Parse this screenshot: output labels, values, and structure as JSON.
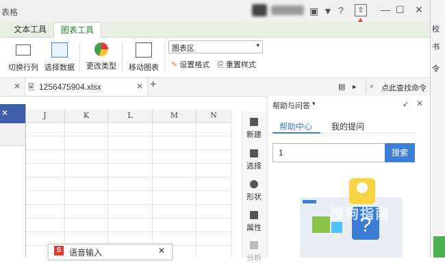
{
  "window": {
    "title": "表格",
    "close": "✕",
    "minimize": "—",
    "maximize": "☐"
  },
  "ribbon_tabs": [
    {
      "label": "文本工具"
    },
    {
      "label": "图表工具"
    }
  ],
  "ribbon": {
    "switch_row_col": "切换行列",
    "select_data": "选择数据",
    "change_type": "更改类型",
    "move_chart": "移动图表",
    "chart_area_select": "图表区",
    "set_format": "设置格式",
    "reset_style": "重置样式"
  },
  "doc_tab": {
    "filename": "1256475904.xlsx",
    "close": "✕",
    "add": "+"
  },
  "search_command": "点此查找命令",
  "columns": [
    "J",
    "K",
    "L",
    "M",
    "N"
  ],
  "side_tools": [
    {
      "label": "新建"
    },
    {
      "label": "选择"
    },
    {
      "label": "形状"
    },
    {
      "label": "属性"
    },
    {
      "label": "分析"
    }
  ],
  "help": {
    "header": "帮助与问答",
    "tab_center": "帮助中心",
    "tab_questions": "我的提问",
    "search_value": "1",
    "search_button": "搜索"
  },
  "voice_input": {
    "label": "语音输入",
    "close": "✕"
  },
  "right_strip": [
    "校",
    "书",
    "令"
  ],
  "watermark": "搜狗指南",
  "colors": {
    "accent_green": "#2e7d32",
    "help_blue": "#3c7ed6",
    "dialog_blue": "#3e5fa8"
  }
}
